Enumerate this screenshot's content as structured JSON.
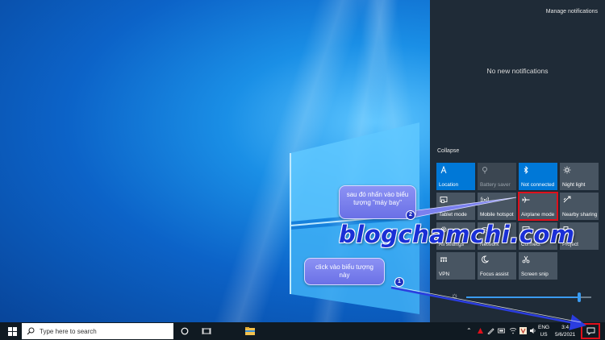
{
  "action_center": {
    "manage_label": "Manage notifications",
    "empty_label": "No new notifications",
    "collapse_label": "Collapse",
    "tiles": [
      {
        "label": "Location",
        "state": "on",
        "icon": "location-icon"
      },
      {
        "label": "Battery saver",
        "state": "disabled",
        "icon": "battery-saver-icon"
      },
      {
        "label": "Not connected",
        "state": "on",
        "icon": "bluetooth-icon"
      },
      {
        "label": "Night light",
        "state": "off",
        "icon": "night-light-icon"
      },
      {
        "label": "Tablet mode",
        "state": "off",
        "icon": "tablet-mode-icon"
      },
      {
        "label": "Mobile hotspot",
        "state": "off",
        "icon": "mobile-hotspot-icon"
      },
      {
        "label": "Airplane mode",
        "state": "off",
        "icon": "airplane-icon",
        "highlighted": true
      },
      {
        "label": "Nearby sharing",
        "state": "off",
        "icon": "nearby-sharing-icon"
      },
      {
        "label": "All settings",
        "state": "off",
        "icon": "settings-icon"
      },
      {
        "label": "Network",
        "state": "off",
        "icon": "network-icon"
      },
      {
        "label": "Connect",
        "state": "off",
        "icon": "connect-icon"
      },
      {
        "label": "Project",
        "state": "off",
        "icon": "project-icon"
      },
      {
        "label": "VPN",
        "state": "off",
        "icon": "vpn-icon"
      },
      {
        "label": "Focus assist",
        "state": "off",
        "icon": "focus-assist-icon"
      },
      {
        "label": "Screen snip",
        "state": "off",
        "icon": "screen-snip-icon"
      }
    ],
    "brightness_level": 0.9
  },
  "taskbar": {
    "search_placeholder": "Type here to search",
    "language_line1": "ENG",
    "language_line2": "US",
    "clock_time": "3:4",
    "clock_date": "5/6/2021"
  },
  "annotations": {
    "callout_1_text": "click vào biểu tượng này",
    "callout_1_number": "1",
    "callout_2_text": "sau đó nhấn vào biểu tượng \"máy bay\"",
    "callout_2_number": "2",
    "watermark": "blogchamchi.com"
  },
  "colors": {
    "tile_on": "#0078d7",
    "tile_off": "#485562",
    "highlight": "#e0101b",
    "panel": "#1f2b37",
    "taskbar": "#101a22"
  }
}
